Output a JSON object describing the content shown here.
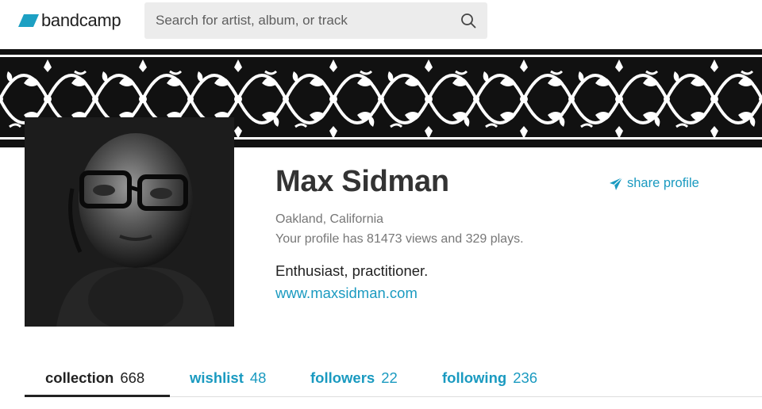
{
  "header": {
    "logo_text": "bandcamp",
    "search_placeholder": "Search for artist, album, or track",
    "brand_color": "#1da0c3"
  },
  "profile": {
    "name": "Max Sidman",
    "location": "Oakland, California",
    "stats": "Your profile has 81473 views and 329 plays.",
    "bio": "Enthusiast, practitioner.",
    "website": "www.maxsidman.com",
    "share_label": "share profile",
    "link_color": "#1a9ac0"
  },
  "tabs": [
    {
      "label": "collection",
      "count": "668",
      "active": true
    },
    {
      "label": "wishlist",
      "count": "48",
      "active": false
    },
    {
      "label": "followers",
      "count": "22",
      "active": false
    },
    {
      "label": "following",
      "count": "236",
      "active": false
    }
  ],
  "icons": {
    "search": "magnifier-icon",
    "share": "paper-plane-icon",
    "logo": "parallelogram-logo"
  }
}
